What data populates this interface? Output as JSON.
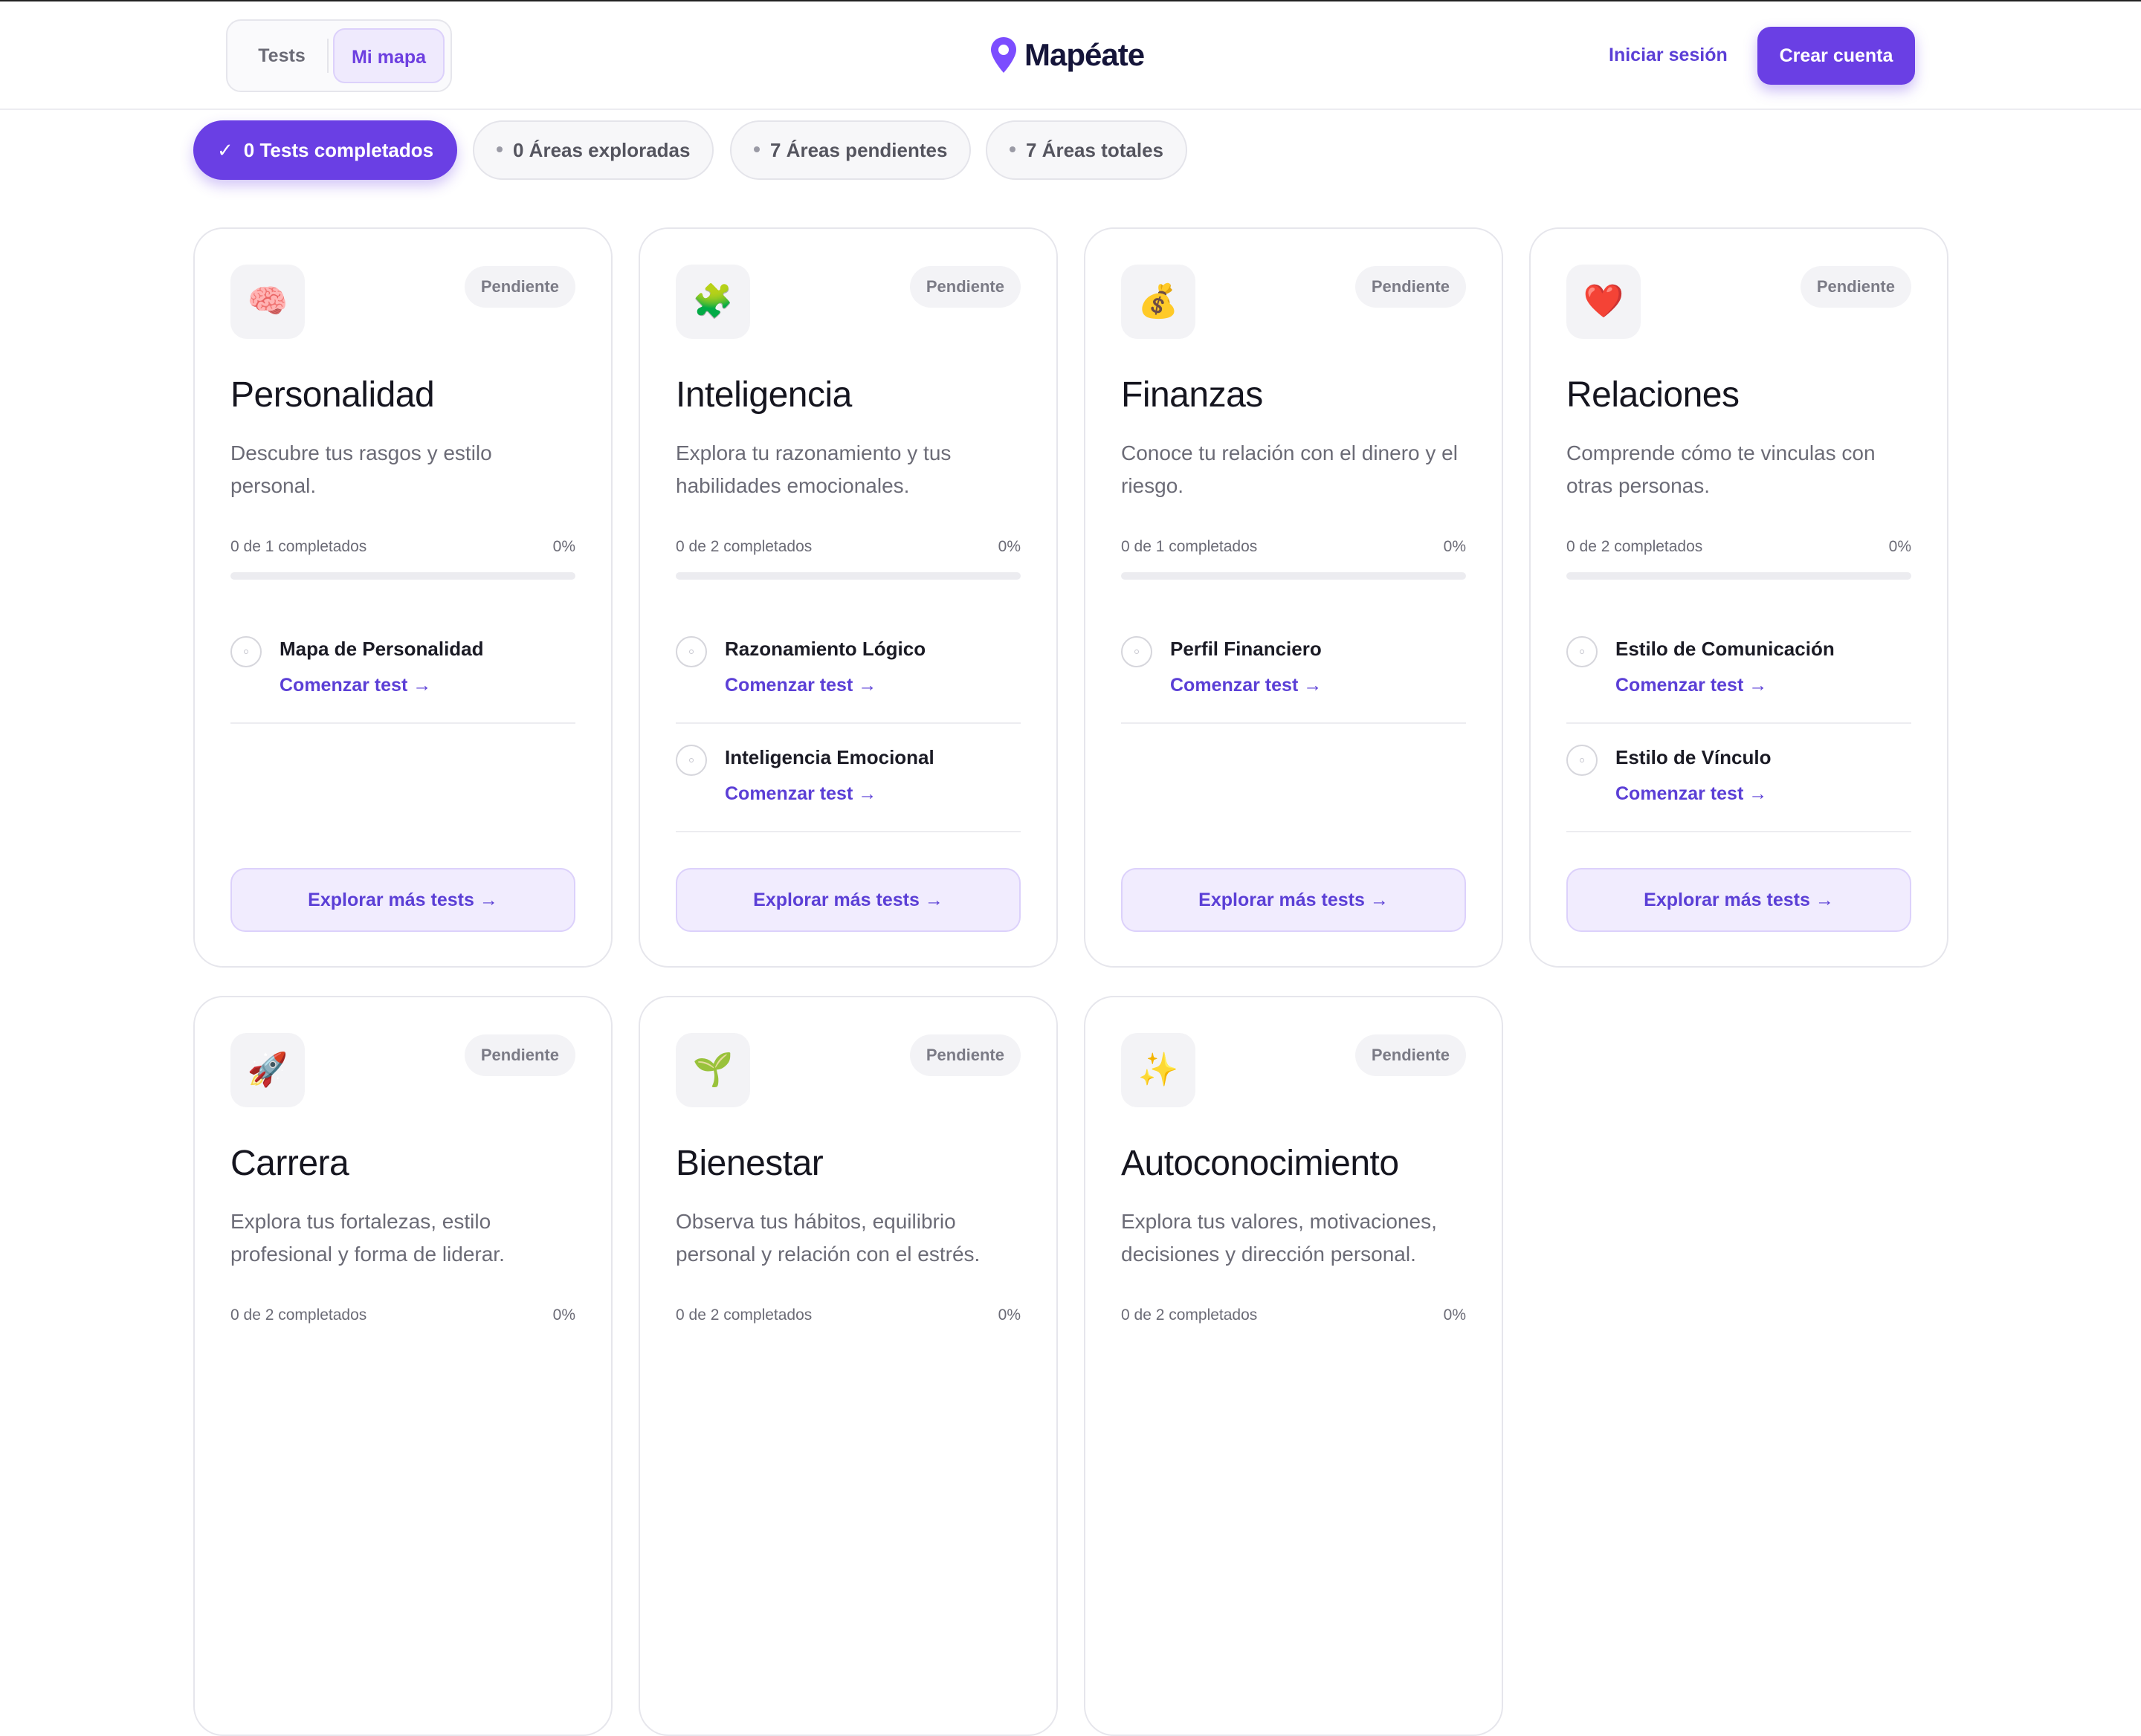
{
  "header": {
    "tabs": [
      {
        "label": "Tests"
      },
      {
        "label": "Mi mapa"
      }
    ],
    "brand": "Mapéate",
    "login_label": "Iniciar sesión",
    "signup_label": "Crear cuenta"
  },
  "stats": [
    {
      "label": "0 Tests completados",
      "active": true
    },
    {
      "label": "0 Áreas exploradas"
    },
    {
      "label": "7 Áreas pendientes"
    },
    {
      "label": "7 Áreas totales"
    }
  ],
  "colors": {
    "accent": "#6a3fe4",
    "accent_text": "#5b3fd6",
    "accent_soft": "#f1ecfe"
  },
  "areas": [
    {
      "icon": "brain-icon",
      "emoji": "🧠",
      "status": "Pendiente",
      "title": "Personalidad",
      "description": "Descubre tus rasgos y estilo personal.",
      "progress_text": "0 de 1 completados",
      "percent": "0%",
      "progress": 0,
      "tests": [
        {
          "name": "Mapa de Personalidad",
          "cta": "Comenzar test →"
        }
      ],
      "explore_label": "Explorar más tests →"
    },
    {
      "icon": "puzzle-icon",
      "emoji": "🧩",
      "status": "Pendiente",
      "title": "Inteligencia",
      "description": "Explora tu razonamiento y tus habilidades emocionales.",
      "progress_text": "0 de 2 completados",
      "percent": "0%",
      "progress": 0,
      "tests": [
        {
          "name": "Razonamiento Lógico",
          "cta": "Comenzar test →"
        },
        {
          "name": "Inteligencia Emocional",
          "cta": "Comenzar test →"
        }
      ],
      "explore_label": "Explorar más tests →"
    },
    {
      "icon": "money-bag-icon",
      "emoji": "💰",
      "status": "Pendiente",
      "title": "Finanzas",
      "description": "Conoce tu relación con el dinero y el riesgo.",
      "progress_text": "0 de 1 completados",
      "percent": "0%",
      "progress": 0,
      "tests": [
        {
          "name": "Perfil Financiero",
          "cta": "Comenzar test →"
        }
      ],
      "explore_label": "Explorar más tests →"
    },
    {
      "icon": "heart-icon",
      "emoji": "❤️",
      "status": "Pendiente",
      "title": "Relaciones",
      "description": "Comprende cómo te vinculas con otras personas.",
      "progress_text": "0 de 2 completados",
      "percent": "0%",
      "progress": 0,
      "tests": [
        {
          "name": "Estilo de Comunicación",
          "cta": "Comenzar test →"
        },
        {
          "name": "Estilo de Vínculo",
          "cta": "Comenzar test →"
        }
      ],
      "explore_label": "Explorar más tests →"
    },
    {
      "icon": "rocket-icon",
      "emoji": "🚀",
      "status": "Pendiente",
      "title": "Carrera",
      "description": "Explora tus fortalezas, estilo profesional y forma de liderar.",
      "progress_text": "0 de 2 completados",
      "percent": "0%",
      "progress": 0,
      "tests": [],
      "explore_label": ""
    },
    {
      "icon": "seedling-icon",
      "emoji": "🌱",
      "status": "Pendiente",
      "title": "Bienestar",
      "description": "Observa tus hábitos, equilibrio personal y relación con el estrés.",
      "progress_text": "0 de 2 completados",
      "percent": "0%",
      "progress": 0,
      "tests": [],
      "explore_label": ""
    },
    {
      "icon": "sparkles-icon",
      "emoji": "✨",
      "status": "Pendiente",
      "title": "Autoconocimiento",
      "description": "Explora tus valores, motivaciones, decisiones y dirección personal.",
      "progress_text": "0 de 2 completados",
      "percent": "0%",
      "progress": 0,
      "tests": [],
      "explore_label": ""
    }
  ]
}
